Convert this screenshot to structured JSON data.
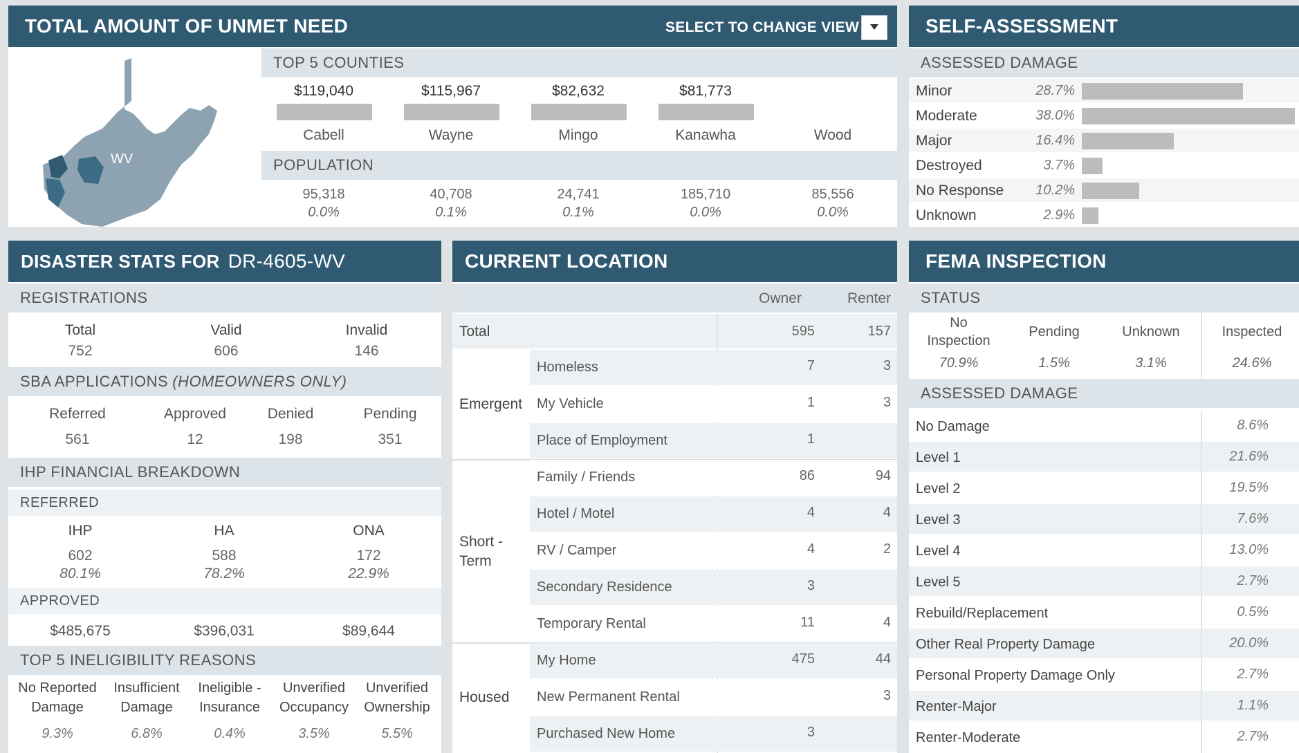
{
  "unmet": {
    "title": "TOTAL AMOUNT OF UNMET NEED",
    "select_label": "SELECT TO CHANGE VIEW",
    "map_label": "WV",
    "top5_header": "TOP 5 COUNTIES",
    "population_header": "POPULATION",
    "counties": [
      {
        "name": "Cabell",
        "amount": "$119,040",
        "amount_value": 119040,
        "population": "95,318",
        "pct": "0.0%"
      },
      {
        "name": "Wayne",
        "amount": "$115,967",
        "amount_value": 115967,
        "population": "40,708",
        "pct": "0.1%"
      },
      {
        "name": "Mingo",
        "amount": "$82,632",
        "amount_value": 82632,
        "population": "24,741",
        "pct": "0.1%"
      },
      {
        "name": "Kanawha",
        "amount": "$81,773",
        "amount_value": 81773,
        "population": "185,710",
        "pct": "0.0%"
      },
      {
        "name": "Wood",
        "amount": "",
        "amount_value": 0,
        "population": "85,556",
        "pct": "0.0%"
      }
    ]
  },
  "self": {
    "title": "SELF-ASSESSMENT",
    "sub": "ASSESSED DAMAGE",
    "rows": [
      {
        "label": "Minor",
        "pct": "28.7%",
        "value": 28.7
      },
      {
        "label": "Moderate",
        "pct": "38.0%",
        "value": 38.0
      },
      {
        "label": "Major",
        "pct": "16.4%",
        "value": 16.4
      },
      {
        "label": "Destroyed",
        "pct": "3.7%",
        "value": 3.7
      },
      {
        "label": "No Response",
        "pct": "10.2%",
        "value": 10.2
      },
      {
        "label": "Unknown",
        "pct": "2.9%",
        "value": 2.9
      }
    ]
  },
  "stats": {
    "title_prefix": "DISASTER STATS FOR",
    "disaster_id": "DR-4605-WV",
    "registrations": {
      "header": "REGISTRATIONS",
      "cols": [
        {
          "label": "Total",
          "value": "752"
        },
        {
          "label": "Valid",
          "value": "606"
        },
        {
          "label": "Invalid",
          "value": "146"
        }
      ]
    },
    "sba": {
      "header": "SBA APPLICATIONS",
      "header_note": "(HOMEOWNERS ONLY)",
      "cols": [
        {
          "label": "Referred",
          "value": "561"
        },
        {
          "label": "Approved",
          "value": "12"
        },
        {
          "label": "Denied",
          "value": "198"
        },
        {
          "label": "Pending",
          "value": "351"
        }
      ]
    },
    "ihp": {
      "header": "IHP FINANCIAL BREAKDOWN",
      "referred_header": "REFERRED",
      "approved_header": "APPROVED",
      "cols": [
        {
          "label": "IHP",
          "value": "602",
          "pct": "80.1%",
          "approved": "$485,675"
        },
        {
          "label": "HA",
          "value": "588",
          "pct": "78.2%",
          "approved": "$396,031"
        },
        {
          "label": "ONA",
          "value": "172",
          "pct": "22.9%",
          "approved": "$89,644"
        }
      ]
    },
    "inelig": {
      "header": "TOP 5 INELIGIBILITY REASONS",
      "cols": [
        {
          "line1": "No Reported",
          "line2": "Damage",
          "pct": "9.3%"
        },
        {
          "line1": "Insufficient",
          "line2": "Damage",
          "pct": "6.8%"
        },
        {
          "line1": "Ineligible -",
          "line2": "Insurance",
          "pct": "0.4%"
        },
        {
          "line1": "Unverified",
          "line2": "Occupancy",
          "pct": "3.5%"
        },
        {
          "line1": "Unverified",
          "line2": "Ownership",
          "pct": "5.5%"
        }
      ]
    }
  },
  "location": {
    "title": "CURRENT LOCATION",
    "col_owner": "Owner",
    "col_renter": "Renter",
    "total": {
      "label": "Total",
      "owner": "595",
      "renter": "157"
    },
    "groups": [
      {
        "name": "Emergent",
        "name2": "",
        "rows": [
          {
            "label": "Homeless",
            "owner": "7",
            "renter": "3"
          },
          {
            "label": "My Vehicle",
            "owner": "1",
            "renter": "3"
          },
          {
            "label": "Place of Employment",
            "owner": "1",
            "renter": ""
          }
        ]
      },
      {
        "name": "Short -",
        "name2": "Term",
        "rows": [
          {
            "label": "Family / Friends",
            "owner": "86",
            "renter": "94"
          },
          {
            "label": "Hotel / Motel",
            "owner": "4",
            "renter": "4"
          },
          {
            "label": "RV / Camper",
            "owner": "4",
            "renter": "2"
          },
          {
            "label": "Secondary Residence",
            "owner": "3",
            "renter": ""
          },
          {
            "label": "Temporary Rental",
            "owner": "11",
            "renter": "4"
          }
        ]
      },
      {
        "name": "Housed",
        "name2": "",
        "rows": [
          {
            "label": "My Home",
            "owner": "475",
            "renter": "44"
          },
          {
            "label": "New Permanent Rental",
            "owner": "",
            "renter": "3"
          },
          {
            "label": "Purchased New Home",
            "owner": "3",
            "renter": ""
          }
        ]
      }
    ]
  },
  "fema": {
    "title": "FEMA INSPECTION",
    "status_header": "STATUS",
    "status": [
      {
        "line1": "No",
        "line2": "Inspection",
        "pct": "70.9%"
      },
      {
        "line1": "Pending",
        "line2": "",
        "pct": "1.5%"
      },
      {
        "line1": "Unknown",
        "line2": "",
        "pct": "3.1%"
      },
      {
        "line1": "Inspected",
        "line2": "",
        "pct": "24.6%"
      }
    ],
    "damage_header": "ASSESSED DAMAGE",
    "damage": [
      {
        "label": "No Damage",
        "pct": "8.6%"
      },
      {
        "label": "Level 1",
        "pct": "21.6%"
      },
      {
        "label": "Level 2",
        "pct": "19.5%"
      },
      {
        "label": "Level 3",
        "pct": "7.6%"
      },
      {
        "label": "Level 4",
        "pct": "13.0%"
      },
      {
        "label": "Level 5",
        "pct": "2.7%"
      },
      {
        "label": "Rebuild/Replacement",
        "pct": "0.5%"
      },
      {
        "label": "Other Real Property Damage",
        "pct": "20.0%"
      },
      {
        "label": "Personal Property Damage Only",
        "pct": "2.7%"
      },
      {
        "label": "Renter-Major",
        "pct": "1.1%"
      },
      {
        "label": "Renter-Moderate",
        "pct": "2.7%"
      }
    ]
  },
  "colors": {
    "header": "#2f5a72",
    "subheader": "#dce4ea",
    "bar": "#bcbcbc",
    "map_state": "#8ea3b1",
    "map_highlight": "#2f5a72"
  }
}
